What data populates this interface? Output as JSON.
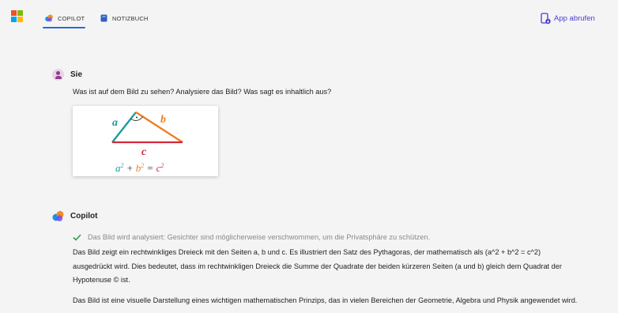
{
  "header": {
    "tabs": [
      {
        "label": "COPILOT",
        "active": true
      },
      {
        "label": "NOTIZBUCH",
        "active": false
      }
    ],
    "app_button_label": "App abrufen"
  },
  "user_message": {
    "author": "Sie",
    "text": "Was ist auf dem Bild zu sehen? Analysiere das Bild? Was sagt es inhaltlich aus?"
  },
  "copilot_message": {
    "author": "Copilot",
    "status": "Das Bild wird analysiert: Gesichter sind möglicherweise verschwommen, um die Privatsphäre zu schützen.",
    "paragraph1_lines": [
      "Das Bild zeigt ein rechtwinkliges Dreieck mit den Seiten a, b und c. Es illustriert den Satz des Pythagoras, der mathematisch als (a^2 + b^2 = c^2)",
      "ausgedrückt wird. Dies bedeutet, dass im rechtwinkligen Dreieck die Summe der Quadrate der beiden kürzeren Seiten (a und b) gleich dem Quadrat der",
      "Hypotenuse © ist."
    ],
    "paragraph2": "Das Bild ist eine visuelle Darstellung eines wichtigen mathematischen Prinzips, das in vielen Bereichen der Geometrie, Algebra und Physik angewendet wird."
  },
  "colors": {
    "accent": "#2c6bd1",
    "app_button": "#4a3ad8",
    "side_a": "#1a9b9b",
    "side_b": "#f07d1e",
    "side_c": "#d6283c"
  },
  "icons": [
    "microsoft-logo",
    "copilot-icon",
    "notebook-icon",
    "phone-download-icon",
    "user-avatar",
    "checkmark-icon"
  ]
}
